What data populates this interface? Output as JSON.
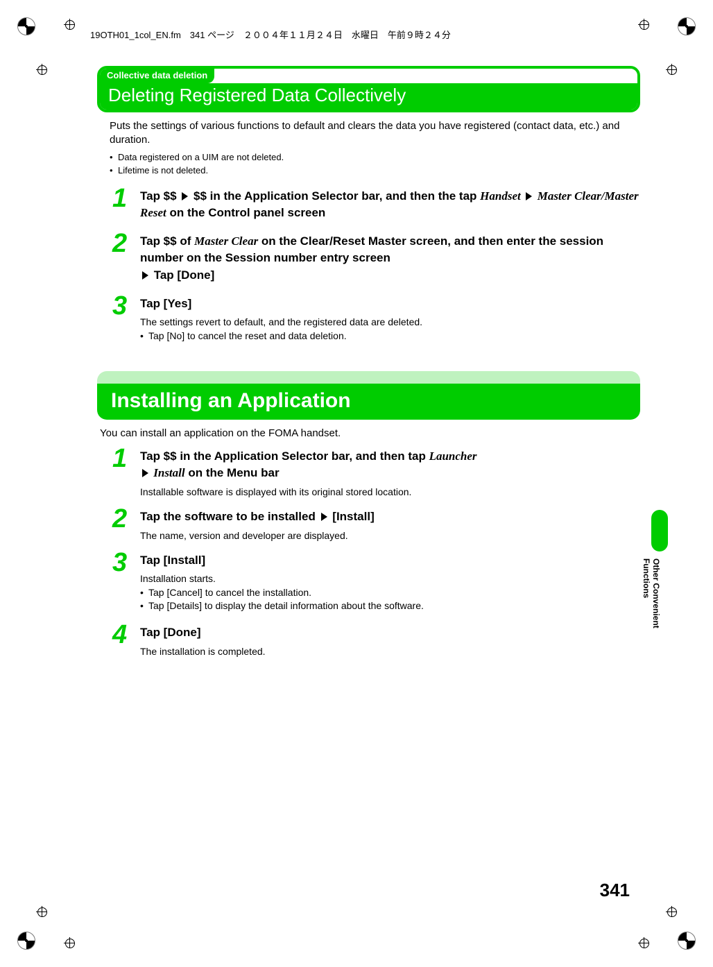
{
  "header_line": "19OTH01_1col_EN.fm　341 ページ　２００４年１１月２４日　水曜日　午前９時２４分",
  "section1": {
    "tag": "Collective data deletion",
    "title": "Deleting Registered Data Collectively",
    "intro": "Puts the settings of various functions to default and clears the data you have registered (contact data, etc.) and duration.",
    "bullets": [
      "Data registered on a UIM are not deleted.",
      "Lifetime is not deleted."
    ],
    "steps": [
      {
        "num": "1",
        "title_parts": {
          "p1": "Tap $$ ",
          "p2": " $$ in the Application Selector bar, and then the tap ",
          "serif1": "Handset",
          "serif2": " Master Clear/Master Reset",
          "p3": " on the Control panel screen"
        }
      },
      {
        "num": "2",
        "title_parts": {
          "p1": "Tap $$ of ",
          "serif1": "Master Clear",
          "p2": " on the Clear/Reset Master screen, and then enter the session number on the Session number entry screen ",
          "p3": " Tap [Done]"
        }
      },
      {
        "num": "3",
        "title": "Tap [Yes]",
        "desc": "The settings revert to default, and the registered data are deleted.",
        "bullets": [
          "Tap [No] to cancel the reset and data deletion."
        ]
      }
    ]
  },
  "section2": {
    "title": "Installing an Application",
    "intro": "You can install an application on the FOMA handset.",
    "steps": [
      {
        "num": "1",
        "title_parts": {
          "p1": "Tap $$ in the Application Selector bar, and then tap ",
          "serif1": "Launcher",
          "serif2": " Install",
          "p2": " on the Menu bar"
        },
        "desc": "Installable software is displayed with its original stored location."
      },
      {
        "num": "2",
        "title_parts": {
          "p1": "Tap the software to be installed ",
          "p2": " [Install]"
        },
        "desc": "The name, version and developer are displayed."
      },
      {
        "num": "3",
        "title": "Tap [Install]",
        "desc": "Installation starts.",
        "bullets": [
          "Tap [Cancel] to cancel the installation.",
          "Tap [Details] to display the detail information about the software."
        ]
      },
      {
        "num": "4",
        "title": "Tap [Done]",
        "desc": "The installation is completed."
      }
    ]
  },
  "side_label": "Other Convenient Functions",
  "page_number": "341"
}
